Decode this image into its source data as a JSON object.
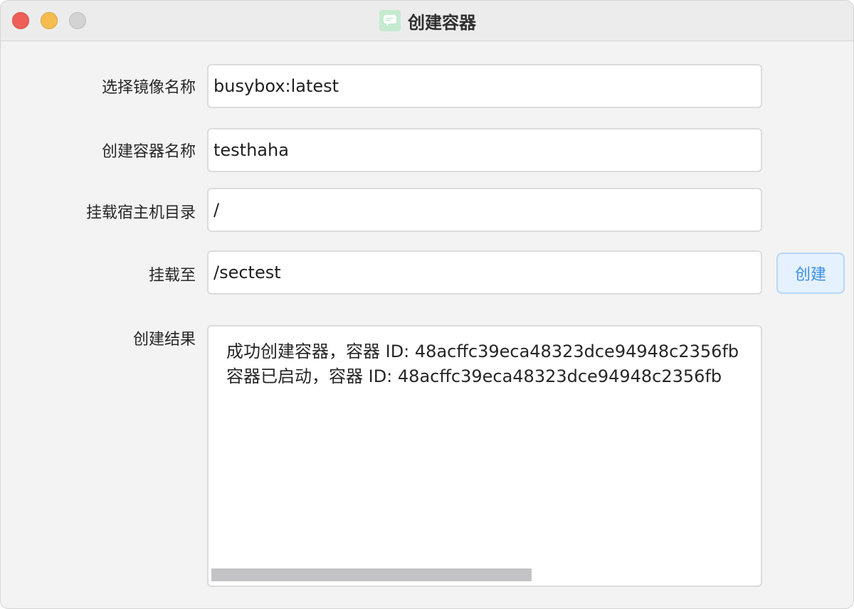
{
  "window": {
    "title": "创建容器",
    "app_icon": "chat-bubble-icon",
    "traffic_lights": {
      "close": "#ee5f57",
      "minimize": "#f5bd4f",
      "maximize": "#d3d3d3"
    }
  },
  "form": {
    "image_name": {
      "label": "选择镜像名称",
      "value": "busybox:latest"
    },
    "container_name": {
      "label": "创建容器名称",
      "value": "testhaha"
    },
    "host_dir": {
      "label": "挂载宿主机目录",
      "value": "/"
    },
    "mount_to": {
      "label": "挂载至",
      "value": "/sectest"
    },
    "create_button": {
      "label": "创建",
      "color": "#3a8ee6"
    }
  },
  "result": {
    "label": "创建结果",
    "lines": [
      "成功创建容器，容器 ID: 48acffc39eca48323dce94948c2356fb",
      "容器已启动，容器 ID: 48acffc39eca48323dce94948c2356fb"
    ]
  }
}
